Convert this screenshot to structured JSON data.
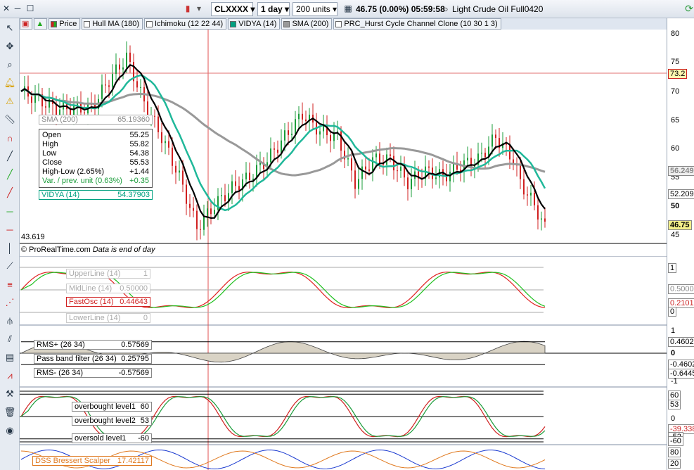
{
  "topbar": {
    "symbol": "CLXXXX",
    "timeframe": "1 day",
    "units": "200 units",
    "quote": "46.75 (0.00%) 05:59:58",
    "instrument": "Light Crude Oil Full0420"
  },
  "indicators": [
    "Price",
    "Hull MA (180)",
    "Ichimoku (12 22 44)",
    "VIDYA (14)",
    "SMA (200)",
    "PRC_Hurst Cycle Channel Clone (10 30 1 3)"
  ],
  "price_axis": [
    "80",
    "75",
    "70",
    "65",
    "60",
    "55",
    "50",
    "45"
  ],
  "price_tags": {
    "level": "73.2",
    "sma": "56.249",
    "mid": "52.209",
    "last": "46.75"
  },
  "price_panel": {
    "low_label": "43.619",
    "footer_brand": "© ProRealTime.com",
    "footer_note": "Data is end of day",
    "sma_label": "SMA (200)",
    "sma_value": "65.19360",
    "vidya_label": "VIDYA (14)",
    "vidya_value": "54.37903"
  },
  "ohlc": {
    "open_label": "Open",
    "open": "55.25",
    "high_label": "High",
    "high": "55.82",
    "low_label": "Low",
    "low": "54.38",
    "close_label": "Close",
    "close": "55.53",
    "hl_label": "High-Low (2.65%)",
    "hl": "+1.44",
    "var_label": "Var. / prev. unit (0.63%)",
    "var": "+0.35"
  },
  "osc_panel": {
    "upper_label": "UpperLine (14)",
    "upper": "1",
    "mid_label": "MidLine (14)",
    "mid": "0.50000",
    "fast_label": "FastOsc (14)",
    "fast": "0.44643",
    "lower_label": "LowerLine (14)",
    "lower": "0",
    "axis": [
      "1",
      "0.5000",
      "0.2101",
      "0"
    ]
  },
  "hurst_panel": {
    "rmsp_label": "RMS+ (26 34)",
    "rmsp": "0.57569",
    "band_label": "Pass band filter (26 34)",
    "band": "0.25795",
    "rmsm_label": "RMS- (26 34)",
    "rmsm": "-0.57569",
    "axis": [
      "1",
      "0.4602",
      "0",
      "-0.4602",
      "-0.6445",
      "-1"
    ]
  },
  "ob_panel": {
    "ob1_label": "overbought level1",
    "ob1": "60",
    "ob2_label": "overbought level2",
    "ob2": "53",
    "os_label": "oversold level1",
    "os": "-60",
    "axis": [
      "60",
      "53",
      "0",
      "-39.338",
      "-52",
      "-60"
    ]
  },
  "dss_panel": {
    "label": "DSS Bressert Scalper",
    "value": "17.42117",
    "axis": [
      "80",
      "20"
    ]
  },
  "colors": {
    "accent": "#00a080",
    "up": "#1a9c3a",
    "down": "#d02020",
    "sma": "#999999",
    "hull": "#000000"
  }
}
